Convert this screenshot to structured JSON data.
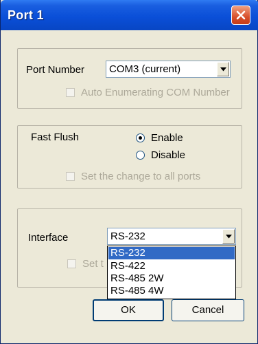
{
  "window": {
    "title": "Port 1"
  },
  "port_group": {
    "port_number_label": "Port Number",
    "port_number_value": "COM3 (current)",
    "auto_enum_label": "Auto Enumerating COM Number",
    "auto_enum_checked": false,
    "auto_enum_enabled": false
  },
  "flush_group": {
    "fast_flush_label": "Fast Flush",
    "enable_label": "Enable",
    "disable_label": "Disable",
    "selected": "Enable",
    "all_ports_label": "Set the change to all ports"
  },
  "interface_group": {
    "interface_label": "Interface",
    "interface_value": "RS-232",
    "partial_checkbox_label": "Set t",
    "options": [
      "RS-232",
      "RS-422",
      "RS-485 2W",
      "RS-485 4W"
    ],
    "highlighted_option": "RS-232"
  },
  "buttons": {
    "ok": "OK",
    "cancel": "Cancel"
  },
  "icons": {
    "close": "close-icon",
    "dropdown": "chevron-down-icon"
  },
  "colors": {
    "title_bar": "#0a4fd8",
    "selection": "#316ac5",
    "close": "#d8502c"
  }
}
